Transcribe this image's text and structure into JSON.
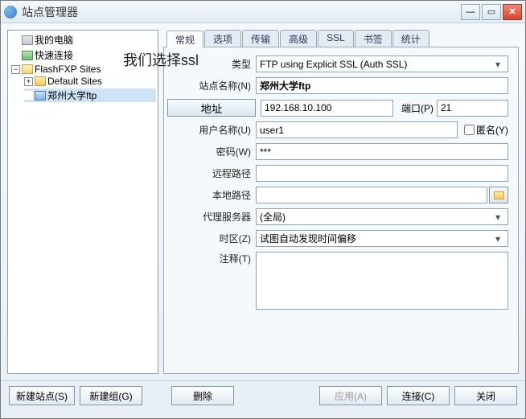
{
  "window": {
    "title": "站点管理器"
  },
  "annotation": "我们选择ssl",
  "tree": {
    "my_computer": "我的电脑",
    "quick_connect": "快速连接",
    "flashfxp_sites": "FlashFXP Sites",
    "default_sites": "Default Sites",
    "zzu_ftp": "郑州大学ftp"
  },
  "tabs": {
    "general": "常规",
    "options": "选项",
    "transfer": "传输",
    "advanced": "高级",
    "ssl": "SSL",
    "bookmarks": "书签",
    "stats": "统计"
  },
  "form": {
    "type_label": "类型",
    "type_value": "FTP using Explicit SSL (Auth SSL)",
    "site_name_label": "站点名称(N)",
    "site_name_value": "郑州大学ftp",
    "address_btn": "地址",
    "address_value": "192.168.10.100",
    "port_label": "端口(P)",
    "port_value": "21",
    "user_label": "用户名称(U)",
    "user_value": "user1",
    "anon_label": "匿名(Y)",
    "password_label": "密码(W)",
    "password_value": "***",
    "remote_label": "远程路径",
    "remote_value": "",
    "local_label": "本地路径",
    "local_value": "",
    "proxy_label": "代理服务器",
    "proxy_value": "(全局)",
    "tz_label": "时区(Z)",
    "tz_value": "试图自动发现时间偏移",
    "notes_label": "注释(T)",
    "notes_value": ""
  },
  "footer": {
    "new_site": "新建站点(S)",
    "new_group": "新建组(G)",
    "delete": "删除",
    "apply": "应用(A)",
    "connect": "连接(C)",
    "close": "关闭"
  }
}
